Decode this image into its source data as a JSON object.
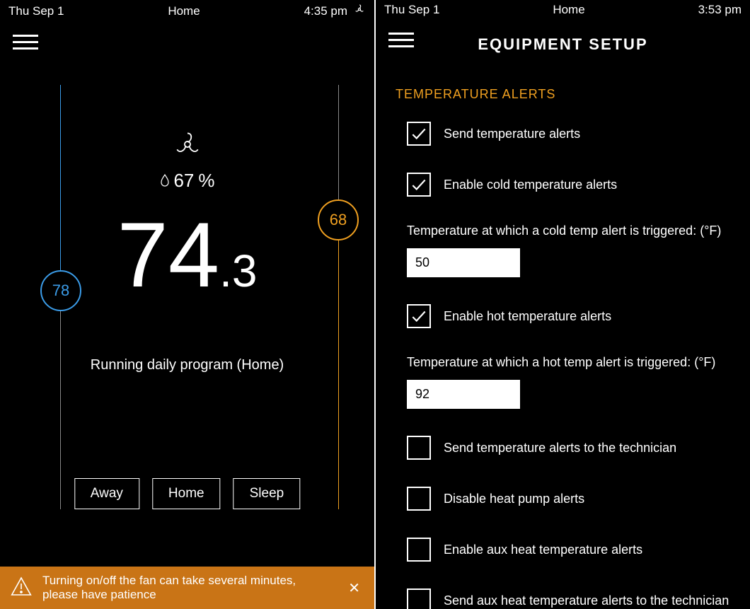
{
  "left": {
    "status": {
      "date": "Thu Sep 1",
      "center": "Home",
      "time": "4:35 pm"
    },
    "humidity_label": "67",
    "humidity_pct": "%",
    "temp_whole": "74",
    "temp_decimal": ".3",
    "setpoint_cool": "78",
    "setpoint_heat": "68",
    "program_status": "Running daily program (Home)",
    "modes": [
      "Away",
      "Home",
      "Sleep"
    ],
    "toast_msg": "Turning on/off the fan can take several minutes, please have patience"
  },
  "right": {
    "status": {
      "date": "Thu Sep 1",
      "center": "Home",
      "time": "3:53 pm"
    },
    "page_title": "EQUIPMENT SETUP",
    "section_title": "TEMPERATURE ALERTS",
    "items": [
      {
        "label": "Send temperature alerts",
        "checked": true
      },
      {
        "label": "Enable cold temperature alerts",
        "checked": true
      }
    ],
    "cold_field_label": "Temperature at which a cold temp alert is triggered: (°F)",
    "cold_value": "50",
    "hot_check": {
      "label": "Enable hot temperature alerts",
      "checked": true
    },
    "hot_field_label": "Temperature at which a hot temp alert is triggered: (°F)",
    "hot_value": "92",
    "items2": [
      {
        "label": "Send temperature alerts to the technician",
        "checked": false
      },
      {
        "label": "Disable heat pump alerts",
        "checked": false
      },
      {
        "label": "Enable aux heat temperature alerts",
        "checked": false
      },
      {
        "label": "Send aux heat temperature alerts to the technician",
        "checked": false
      }
    ]
  }
}
